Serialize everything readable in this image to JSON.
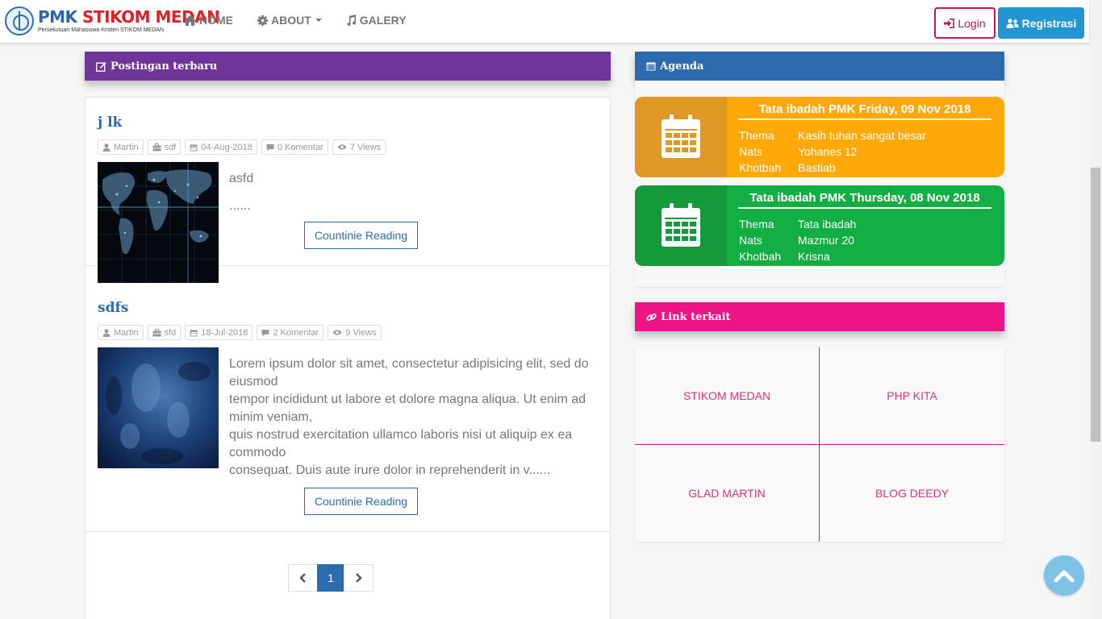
{
  "brand": {
    "name_part1": "PMK",
    "name_part2": "STIKOM MEDAN",
    "subtitle": "Persekutuan Mahasiswa Kristen STIKOM MEDAN"
  },
  "nav": [
    {
      "label": "HOME",
      "icon": "home-icon"
    },
    {
      "label": "ABOUT",
      "icon": "gear-icon"
    },
    {
      "label": "GALERY",
      "icon": "music-icon"
    }
  ],
  "auth": {
    "login": "Login",
    "register": "Registrasi"
  },
  "sections": {
    "posts": "Postingan terbaru",
    "agenda": "Agenda",
    "links": "Link terkait"
  },
  "posts": [
    {
      "title": "j lk",
      "author": "Martin",
      "category": "sdf",
      "date": "04-Aug-2018",
      "comments": "0 Komentar",
      "views": "7 Views",
      "excerpt_lines": [
        "asfd",
        "......"
      ],
      "read_more": "Countinie Reading"
    },
    {
      "title": "sdfs",
      "author": "Martin",
      "category": "sfd",
      "date": "18-Jul-2018",
      "comments": "2 Komentar",
      "views": "9 Views",
      "excerpt_lines": [
        "Lorem ipsum dolor sit amet, consectetur adipisicing elit, sed do eiusmod",
        "tempor incididunt ut labore et dolore magna aliqua. Ut enim ad minim veniam,",
        "quis nostrud exercitation ullamco laboris nisi ut aliquip ex ea commodo",
        "consequat. Duis aute irure dolor in reprehenderit in v......"
      ],
      "read_more": "Countinie Reading"
    }
  ],
  "pagination": {
    "current": "1"
  },
  "agenda": [
    {
      "title": "Tata ibadah PMK Friday, 09 Nov 2018",
      "rows": [
        {
          "key": "Thema",
          "value": "Kasih tuhan sangat besar"
        },
        {
          "key": "Nats",
          "value": "Yohanes 12"
        },
        {
          "key": "Khotbah",
          "value": "Bastiab"
        }
      ],
      "color": "#ffa807",
      "icon_bg": "#e09824"
    },
    {
      "title": "Tata ibadah PMK Thursday, 08 Nov 2018",
      "rows": [
        {
          "key": "Thema",
          "value": "Tata ibadah"
        },
        {
          "key": "Nats",
          "value": "Mazmur 20"
        },
        {
          "key": "Khotbah",
          "value": "Krisna"
        }
      ],
      "color": "#13ae43",
      "icon_bg": "#149a3a"
    }
  ],
  "links": [
    "STIKOM MEDAN",
    "PHP KITA",
    "GLAD MARTIN",
    "BLOG DEEDY"
  ],
  "colors": {
    "posts_header": "#6f3598",
    "agenda_header": "#2d6aad",
    "links_header": "#ee1387",
    "link_text": "#d6337a",
    "primary": "#2a6cad"
  }
}
